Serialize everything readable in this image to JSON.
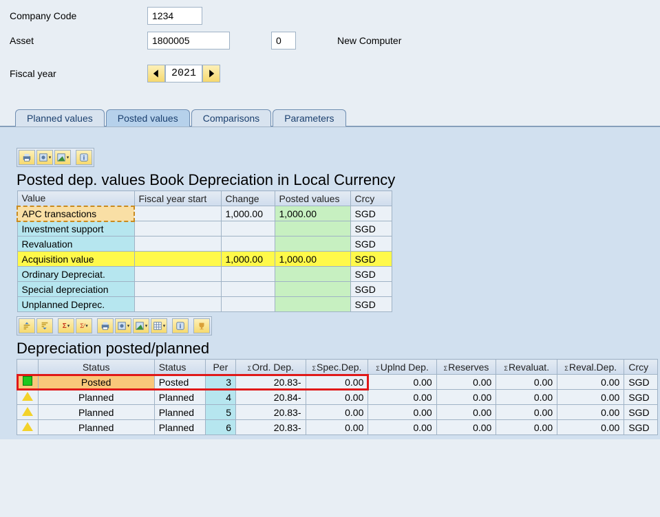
{
  "form": {
    "company_label": "Company Code",
    "company_value": "1234",
    "asset_label": "Asset",
    "asset_value": "1800005",
    "subasset_value": "0",
    "asset_desc": "New Computer",
    "fiscal_label": "Fiscal year",
    "fiscal_value": "2021"
  },
  "tabs": {
    "t0": "Planned values",
    "t1": "Posted values",
    "t2": "Comparisons",
    "t3": "Parameters"
  },
  "table1": {
    "title": "Posted dep. values Book Depreciation in Local Currency",
    "headers": {
      "value": "Value",
      "fys": "Fiscal year start",
      "change": "Change",
      "posted": "Posted values",
      "crcy": "Crcy"
    },
    "rows": [
      {
        "label": "APC transactions",
        "fys": "",
        "change": "1,000.00",
        "posted": "1,000.00",
        "crcy": "SGD",
        "sel": true
      },
      {
        "label": "Investment support",
        "fys": "",
        "change": "",
        "posted": "",
        "crcy": "SGD"
      },
      {
        "label": "Revaluation",
        "fys": "",
        "change": "",
        "posted": "",
        "crcy": "SGD"
      },
      {
        "label": "Acquisition value",
        "fys": "",
        "change": "1,000.00",
        "posted": "1,000.00",
        "crcy": "SGD",
        "hl": true
      },
      {
        "label": "Ordinary Depreciat.",
        "fys": "",
        "change": "",
        "posted": "",
        "crcy": "SGD"
      },
      {
        "label": "Special depreciation",
        "fys": "",
        "change": "",
        "posted": "",
        "crcy": "SGD"
      },
      {
        "label": "Unplanned Deprec.",
        "fys": "",
        "change": "",
        "posted": "",
        "crcy": "SGD"
      }
    ]
  },
  "table2": {
    "title": "Depreciation posted/planned",
    "headers": {
      "status1": "Status",
      "status2": "Status",
      "per": "Per",
      "ord": "Ord. Dep.",
      "spec": "Spec.Dep.",
      "upl": "Uplnd Dep.",
      "res": "Reserves",
      "reval": "Revaluat.",
      "revaldep": "Reval.Dep.",
      "crcy": "Crcy"
    },
    "rows": [
      {
        "icon": "green",
        "s1": "Posted",
        "s2": "Posted",
        "per": "3",
        "ord": "20.83-",
        "spec": "0.00",
        "upl": "0.00",
        "res": "0.00",
        "reval": "0.00",
        "revdep": "0.00",
        "crcy": "SGD",
        "posted": true
      },
      {
        "icon": "tri",
        "s1": "Planned",
        "s2": "Planned",
        "per": "4",
        "ord": "20.84-",
        "spec": "0.00",
        "upl": "0.00",
        "res": "0.00",
        "reval": "0.00",
        "revdep": "0.00",
        "crcy": "SGD"
      },
      {
        "icon": "tri",
        "s1": "Planned",
        "s2": "Planned",
        "per": "5",
        "ord": "20.83-",
        "spec": "0.00",
        "upl": "0.00",
        "res": "0.00",
        "reval": "0.00",
        "revdep": "0.00",
        "crcy": "SGD"
      },
      {
        "icon": "tri",
        "s1": "Planned",
        "s2": "Planned",
        "per": "6",
        "ord": "20.83-",
        "spec": "0.00",
        "upl": "0.00",
        "res": "0.00",
        "reval": "0.00",
        "revdep": "0.00",
        "crcy": "SGD"
      }
    ]
  }
}
